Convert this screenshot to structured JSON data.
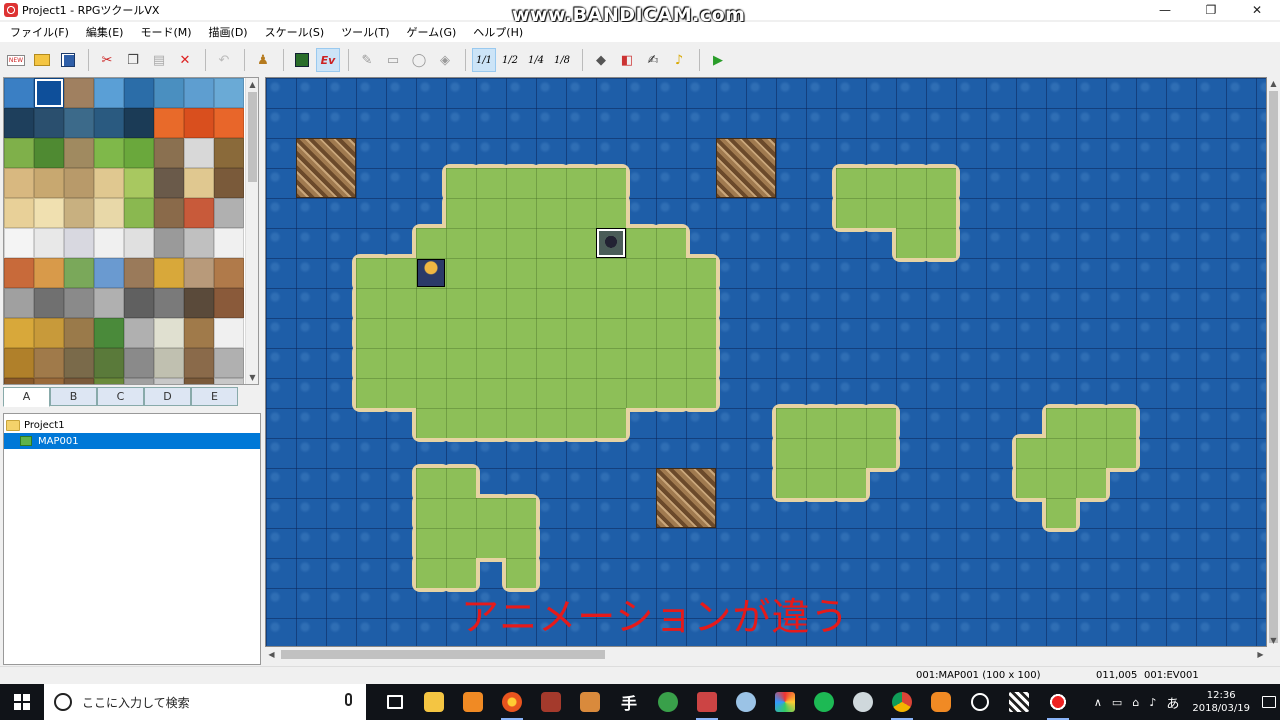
{
  "window": {
    "title": "Project1 - RPGツクールVX",
    "controls": {
      "minimize": "—",
      "maximize": "❐",
      "close": "✕"
    }
  },
  "watermark": "www.BANDICAM.com",
  "menu": [
    "ファイル(F)",
    "編集(E)",
    "モード(M)",
    "描画(D)",
    "スケール(S)",
    "ツール(T)",
    "ゲーム(G)",
    "ヘルプ(H)"
  ],
  "toolbar": {
    "new_label": "NEW",
    "event_label": "Ev",
    "scale_1_1": "1/1",
    "scale_1_2": "1/2",
    "scale_1_4": "1/4",
    "scale_1_8": "1/8",
    "playtest_label": "▶"
  },
  "tileset_tabs": [
    "A",
    "B",
    "C",
    "D",
    "E"
  ],
  "tree": {
    "root": "Project1",
    "maps": [
      "MAP001"
    ]
  },
  "map_annotation": "アニメーションが違う",
  "status": {
    "map_info": "001:MAP001 (100 x 100)",
    "coords": "011,005",
    "event_id": "001:EV001"
  },
  "taskbar": {
    "search_placeholder": "ここに入力して検索",
    "clock_time": "12:36",
    "clock_date": "2018/03/19",
    "ime": "あ",
    "handwriting_app": "手",
    "tray_chevron": "∧"
  },
  "colors": {
    "ocean": "#1e5ea8",
    "grass": "#8dbf58",
    "sand": "#e6d3a3",
    "annotation": "#e61a1a",
    "selection": "#0078d7"
  }
}
